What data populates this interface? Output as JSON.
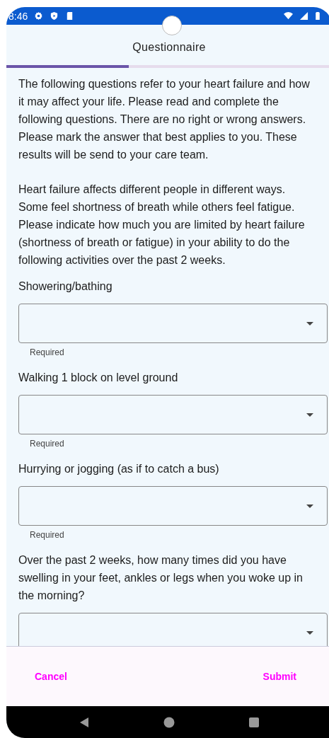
{
  "status_bar": {
    "time": "8:46"
  },
  "app_bar": {
    "title": "Questionnaire"
  },
  "progress": {
    "level": 0.377
  },
  "intro": [
    "The following questions refer to your heart failure and how it may affect your life. Please read and complete the following questions. There are no right or wrong answers. Please mark the answer that best applies to you. These results will be send to your care team.",
    "Heart failure affects different people in different ways. Some feel shortness of breath while others feel fatigue. Please indicate how much you are limited by heart failure (shortness of breath or fatigue) in your ability to do the following activities over the past 2 weeks."
  ],
  "questions": [
    {
      "label": "Showering/bathing",
      "helper": "Required"
    },
    {
      "label": "Walking 1 block on level ground",
      "helper": "Required"
    },
    {
      "label": "Hurrying or jogging (as if to catch a bus)",
      "helper": "Required"
    },
    {
      "label": "Over the past 2 weeks, how many times did you have swelling in your feet, ankles or legs when you woke up in the morning?"
    }
  ],
  "buttons": [
    {
      "label": "Cancel"
    },
    {
      "label": "Submit"
    }
  ]
}
